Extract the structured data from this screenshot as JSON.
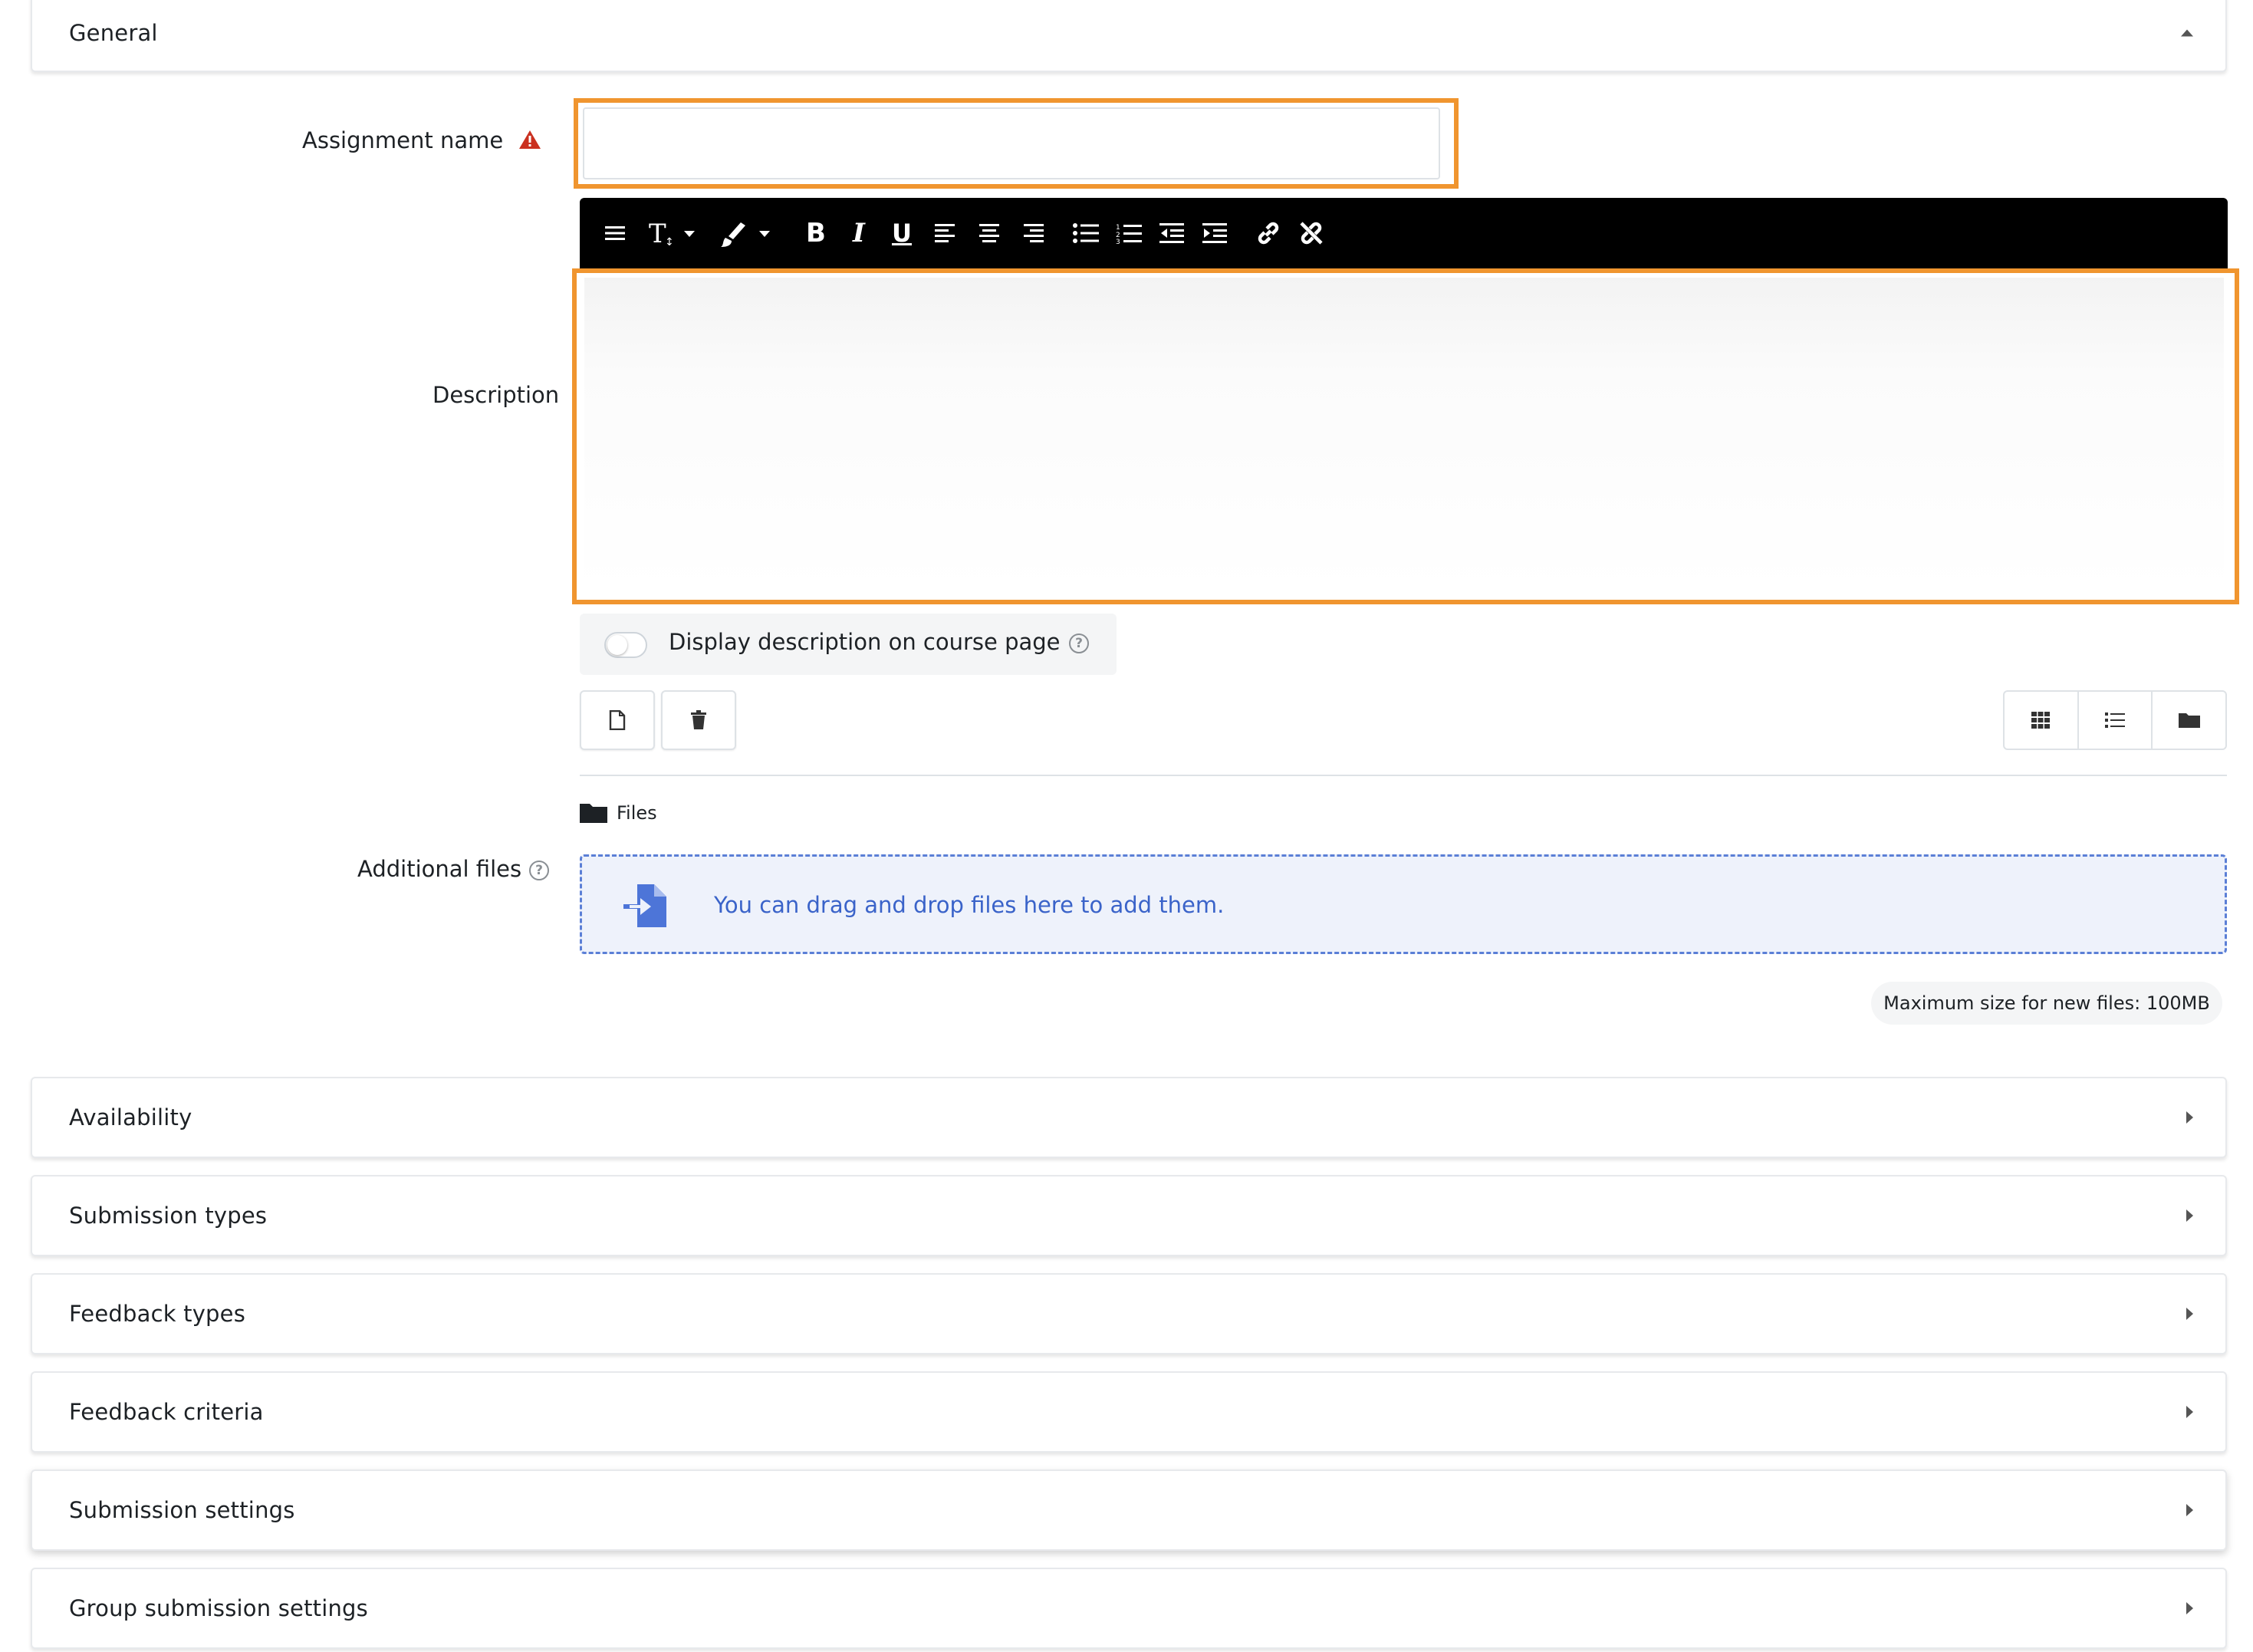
{
  "sections": {
    "general": "General",
    "availability": "Availability",
    "submission_types": "Submission types",
    "feedback_types": "Feedback types",
    "feedback_criteria": "Feedback criteria",
    "submission_settings": "Submission settings",
    "group_submission_settings": "Group submission settings"
  },
  "form": {
    "assignment_name_label": "Assignment name",
    "assignment_name_value": "",
    "description_label": "Description",
    "description_value": "",
    "display_description_label": "Display description on course page",
    "display_description_on": false,
    "additional_files_label": "Additional files",
    "files_folder": "Files",
    "dropzone_text": "You can drag and drop files here to add them.",
    "max_size": "Maximum size for new files: 100MB"
  },
  "editor_toolbar": {
    "items": [
      "menu-icon",
      "font-size-icon",
      "paint-brush-icon",
      "bold-icon",
      "italic-icon",
      "underline-icon",
      "align-left-icon",
      "align-center-icon",
      "align-right-icon",
      "bullet-list-icon",
      "numbered-list-icon",
      "outdent-icon",
      "indent-icon",
      "link-icon",
      "unlink-icon"
    ]
  },
  "colors": {
    "highlight": "#f0952f",
    "required": "#ca3120",
    "dropzone_text": "#3a63c9",
    "toolbar_bg": "#000000"
  }
}
